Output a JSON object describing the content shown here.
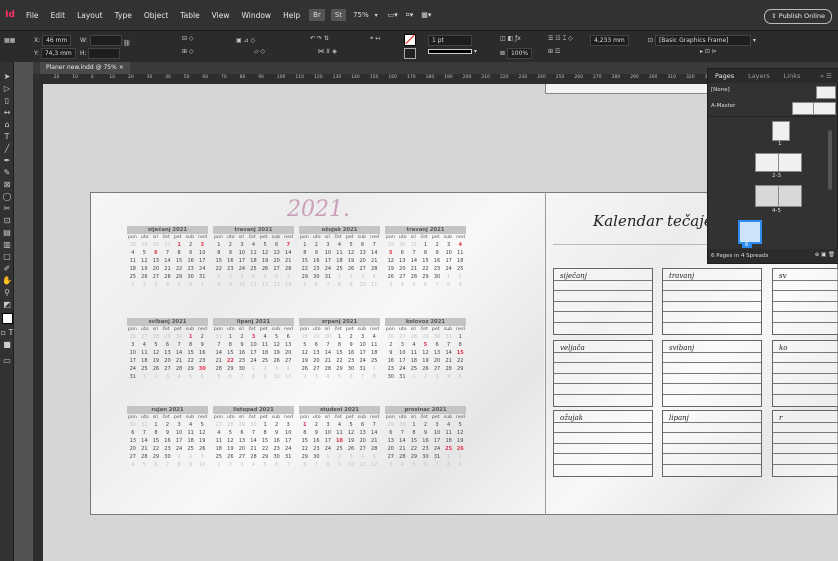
{
  "app": {
    "logo": "Id"
  },
  "menu": [
    "File",
    "Edit",
    "Layout",
    "Type",
    "Object",
    "Table",
    "View",
    "Window",
    "Help"
  ],
  "menubar": {
    "btn1": "Br",
    "btn2": "St",
    "zoom": "75%",
    "publish": "Publish Online"
  },
  "control": {
    "x_label": "X:",
    "x_value": "46 mm",
    "y_label": "Y:",
    "y_value": "74,3 mm",
    "w_label": "W:",
    "h_label": "H:",
    "stroke_weight": "1 pt",
    "percent": "100%",
    "size_value": "4,233 mm",
    "frame_style": "[Basic Graphics Frame]"
  },
  "document": {
    "tab": "Planer new.indd @ 75% ×"
  },
  "ruler": [
    "30",
    "20",
    "10",
    "0",
    "10",
    "20",
    "30",
    "40",
    "50",
    "60",
    "70",
    "80",
    "90",
    "100",
    "110",
    "120",
    "130",
    "140",
    "150",
    "160",
    "170",
    "180",
    "190",
    "200",
    "210",
    "220",
    "230",
    "240",
    "250",
    "260",
    "270",
    "280",
    "290",
    "300",
    "310",
    "320",
    "330",
    "340",
    "350",
    "360",
    "370",
    "380",
    "390",
    "4"
  ],
  "calendar": {
    "year": "2021.",
    "day_names": [
      "pon",
      "uto",
      "sri",
      "čet",
      "pet",
      "sub",
      "ned"
    ],
    "months": [
      {
        "name": "siječanj 2021",
        "start": 4,
        "days": 31,
        "red": [
          1,
          3,
          6
        ]
      },
      {
        "name": "travanj 2021",
        "start": 0,
        "days": 28,
        "red": [
          7
        ]
      },
      {
        "name": "ožujak 2021",
        "start": 0,
        "days": 31,
        "red": []
      },
      {
        "name": "travanj 2021",
        "start": 3,
        "days": 30,
        "red": [
          4,
          5
        ]
      },
      {
        "name": "svibanj 2021",
        "start": 5,
        "days": 31,
        "red": [
          1,
          30
        ]
      },
      {
        "name": "lipanj 2021",
        "start": 1,
        "days": 30,
        "red": [
          3,
          22
        ]
      },
      {
        "name": "srpanj 2021",
        "start": 3,
        "days": 31,
        "red": []
      },
      {
        "name": "kolovoz 2021",
        "start": 6,
        "days": 31,
        "red": [
          5,
          15
        ]
      },
      {
        "name": "rujan 2021",
        "start": 2,
        "days": 30,
        "red": []
      },
      {
        "name": "listopad 2021",
        "start": 4,
        "days": 31,
        "red": []
      },
      {
        "name": "studeni 2021",
        "start": 0,
        "days": 30,
        "red": [
          1,
          18
        ]
      },
      {
        "name": "prosinac 2021",
        "start": 2,
        "days": 31,
        "red": [
          25,
          26
        ]
      }
    ]
  },
  "planner": {
    "title": "Kalendar tečaje",
    "boxes": [
      "siječanj",
      "travanj",
      "sv",
      "veljača",
      "svibanj",
      "ko",
      "ožujak",
      "lipanj",
      "r"
    ]
  },
  "pages_panel": {
    "tabs": [
      "Pages",
      "Layers",
      "Links"
    ],
    "none_label": "[None]",
    "master_label": "A-Master",
    "page_labels": [
      "1",
      "2-3",
      "4-5",
      "6"
    ],
    "footer": "6 Pages in 4 Spreads"
  }
}
